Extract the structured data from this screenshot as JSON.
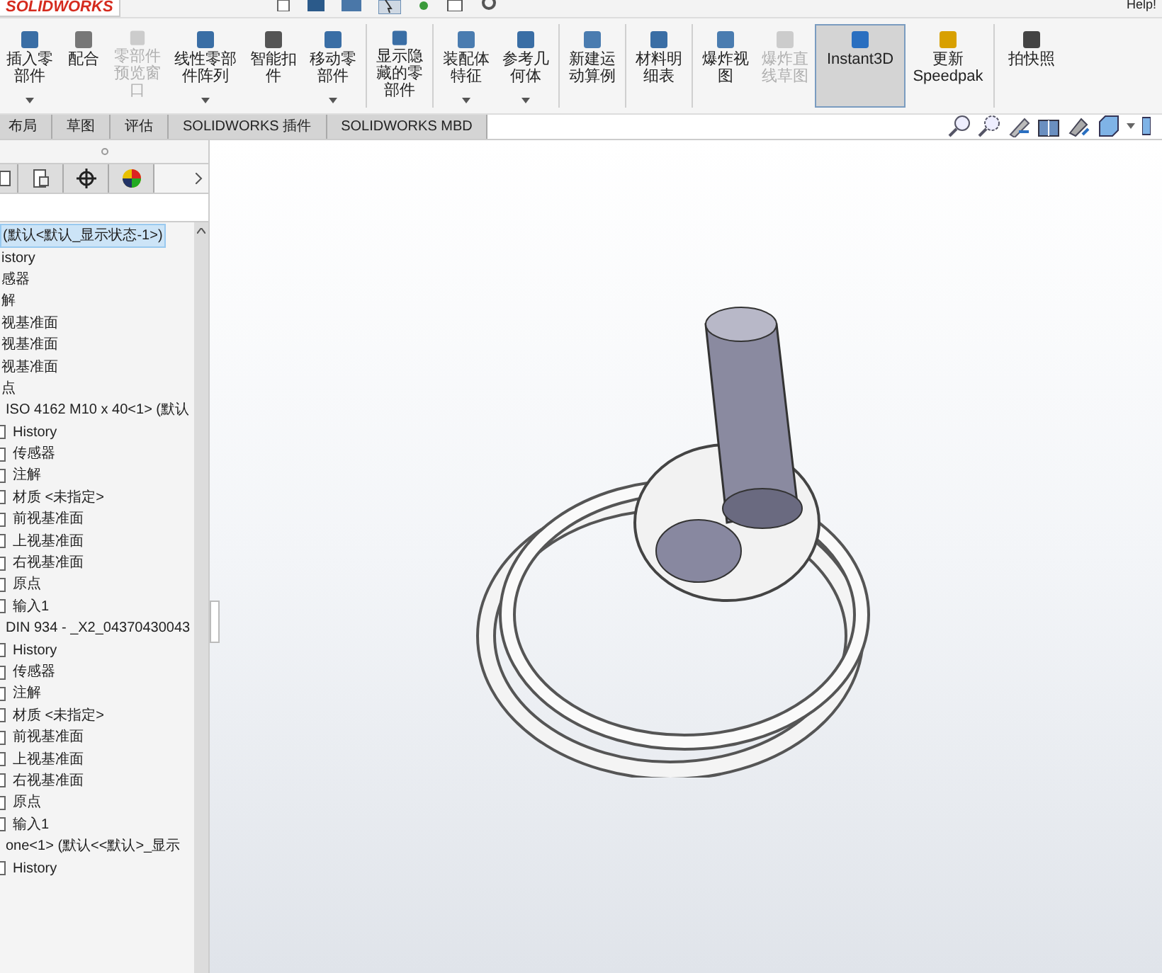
{
  "app": {
    "logo": "SOLIDWORKS",
    "help": "Help!"
  },
  "ribbon": [
    {
      "label": "插入零部件",
      "disabled": false,
      "dropdown": true,
      "selected": false
    },
    {
      "label": "配合",
      "disabled": false,
      "dropdown": false,
      "selected": false
    },
    {
      "label": "零部件预览窗口",
      "disabled": true,
      "dropdown": false,
      "selected": false
    },
    {
      "label": "线性零部件阵列",
      "disabled": false,
      "dropdown": true,
      "selected": false
    },
    {
      "label": "智能扣件",
      "disabled": false,
      "dropdown": false,
      "selected": false
    },
    {
      "label": "移动零部件",
      "disabled": false,
      "dropdown": true,
      "selected": false
    },
    {
      "label": "显示隐藏的零部件",
      "disabled": false,
      "dropdown": false,
      "selected": false
    },
    {
      "label": "装配体特征",
      "disabled": false,
      "dropdown": true,
      "selected": false
    },
    {
      "label": "参考几何体",
      "disabled": false,
      "dropdown": true,
      "selected": false
    },
    {
      "label": "新建运动算例",
      "disabled": false,
      "dropdown": false,
      "selected": false
    },
    {
      "label": "材料明细表",
      "disabled": false,
      "dropdown": false,
      "selected": false
    },
    {
      "label": "爆炸视图",
      "disabled": false,
      "dropdown": false,
      "selected": false
    },
    {
      "label": "爆炸直线草图",
      "disabled": true,
      "dropdown": false,
      "selected": false
    },
    {
      "label": "Instant3D",
      "disabled": false,
      "dropdown": false,
      "selected": true
    },
    {
      "label": "更新 Speedpak",
      "disabled": false,
      "dropdown": false,
      "selected": false
    },
    {
      "label": "拍快照",
      "disabled": false,
      "dropdown": false,
      "selected": false
    }
  ],
  "tabs": [
    {
      "label": "布局",
      "selected": false
    },
    {
      "label": "草图",
      "selected": false
    },
    {
      "label": "评估",
      "selected": false
    },
    {
      "label": "SOLIDWORKS 插件",
      "selected": false
    },
    {
      "label": "SOLIDWORKS MBD",
      "selected": false
    }
  ],
  "tree": [
    {
      "label": "(默认<默认_显示状态-1>)",
      "selected": true,
      "children": [
        {
          "label": "istory",
          "selected": false
        },
        {
          "label": "感器",
          "selected": false
        },
        {
          "label": "解",
          "selected": false
        },
        {
          "label": "视基准面",
          "selected": false
        },
        {
          "label": "视基准面",
          "selected": false
        },
        {
          "label": "视基准面",
          "selected": false
        },
        {
          "label": "点",
          "selected": false
        },
        {
          "label": "ISO 4162 M10 x 40<1> (默认",
          "selected": false,
          "children": [
            {
              "label": "History",
              "selected": false
            },
            {
              "label": "传感器",
              "selected": false
            },
            {
              "label": "注解",
              "selected": false
            },
            {
              "label": "材质 <未指定>",
              "selected": false
            },
            {
              "label": "前视基准面",
              "selected": false
            },
            {
              "label": "上视基准面",
              "selected": false
            },
            {
              "label": "右视基准面",
              "selected": false
            },
            {
              "label": "原点",
              "selected": false
            },
            {
              "label": "输入1",
              "selected": false
            }
          ]
        },
        {
          "label": "DIN 934 - _X2_04370430043",
          "selected": false,
          "children": [
            {
              "label": "History",
              "selected": false
            },
            {
              "label": "传感器",
              "selected": false
            },
            {
              "label": "注解",
              "selected": false
            },
            {
              "label": "材质 <未指定>",
              "selected": false
            },
            {
              "label": "前视基准面",
              "selected": false
            },
            {
              "label": "上视基准面",
              "selected": false
            },
            {
              "label": "右视基准面",
              "selected": false
            },
            {
              "label": "原点",
              "selected": false
            },
            {
              "label": "输入1",
              "selected": false
            }
          ]
        },
        {
          "label": "one<1> (默认<<默认>_显示",
          "selected": false,
          "children": [
            {
              "label": "History",
              "selected": false
            }
          ]
        }
      ]
    }
  ]
}
